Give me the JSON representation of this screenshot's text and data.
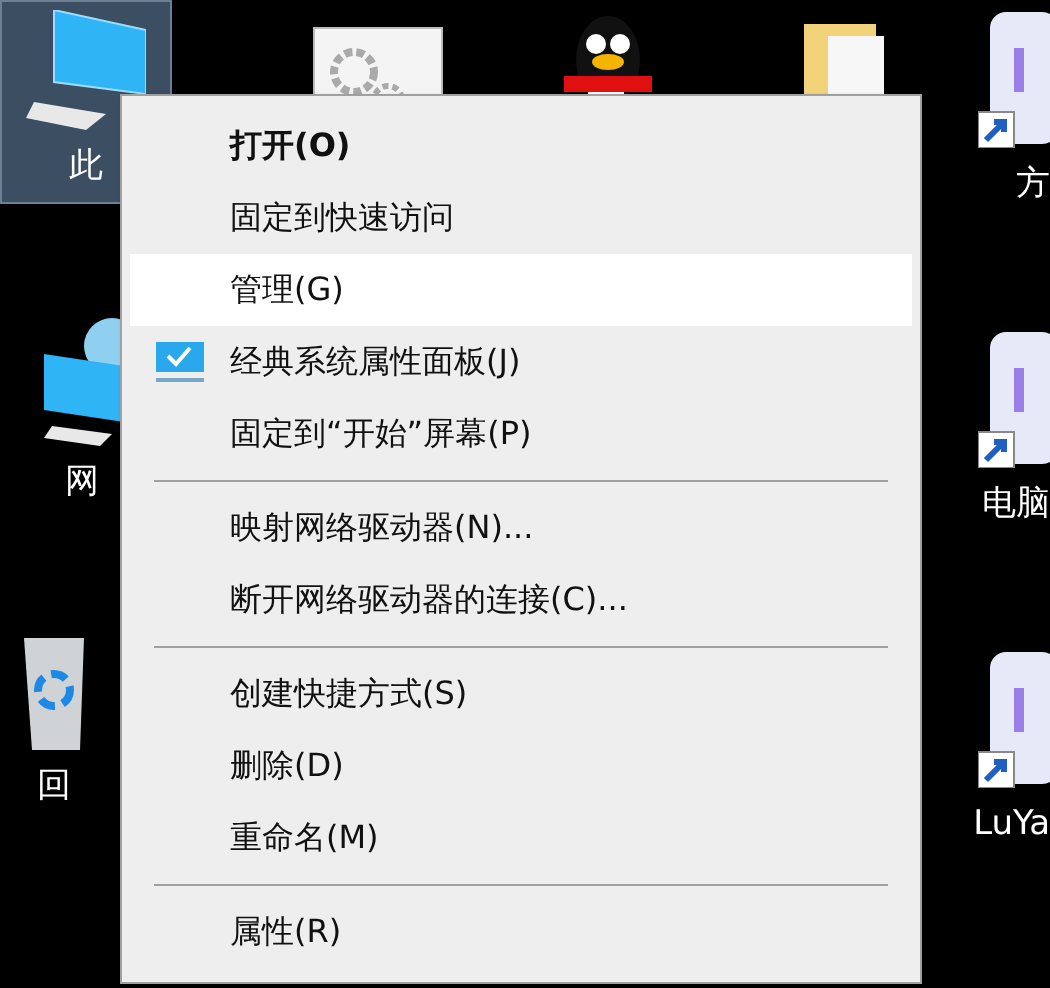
{
  "desktop": {
    "icons": [
      {
        "label": "此",
        "selected": true,
        "kind": "computer"
      },
      {
        "selected": false,
        "kind": "settings"
      },
      {
        "selected": false,
        "kind": "penguin"
      },
      {
        "selected": false,
        "kind": "folder"
      },
      {
        "label": "方",
        "selected": false,
        "kind": "app"
      },
      {
        "label": "网",
        "selected": false,
        "kind": "network"
      },
      {
        "label": "电脑",
        "selected": false,
        "kind": "app"
      },
      {
        "label": "回",
        "selected": false,
        "kind": "recycle"
      },
      {
        "label": "LuYa",
        "selected": false,
        "kind": "app"
      }
    ]
  },
  "context_menu": {
    "items": [
      {
        "kind": "item",
        "label": "打开(O)",
        "default": true,
        "selected": false,
        "icon": false
      },
      {
        "kind": "item",
        "label": "固定到快速访问",
        "default": false,
        "selected": false,
        "icon": false
      },
      {
        "kind": "item",
        "label": "管理(G)",
        "default": false,
        "selected": true,
        "icon": false
      },
      {
        "kind": "item",
        "label": "经典系统属性面板(J)",
        "default": false,
        "selected": false,
        "icon": true
      },
      {
        "kind": "item",
        "label": "固定到“开始”屏幕(P)",
        "default": false,
        "selected": false,
        "icon": false
      },
      {
        "kind": "separator"
      },
      {
        "kind": "item",
        "label": "映射网络驱动器(N)...",
        "default": false,
        "selected": false,
        "icon": false
      },
      {
        "kind": "item",
        "label": "断开网络驱动器的连接(C)...",
        "default": false,
        "selected": false,
        "icon": false
      },
      {
        "kind": "separator"
      },
      {
        "kind": "item",
        "label": "创建快捷方式(S)",
        "default": false,
        "selected": false,
        "icon": false
      },
      {
        "kind": "item",
        "label": "删除(D)",
        "default": false,
        "selected": false,
        "icon": false
      },
      {
        "kind": "item",
        "label": "重命名(M)",
        "default": false,
        "selected": false,
        "icon": false
      },
      {
        "kind": "separator"
      },
      {
        "kind": "item",
        "label": "属性(R)",
        "default": false,
        "selected": false,
        "icon": false
      }
    ]
  }
}
